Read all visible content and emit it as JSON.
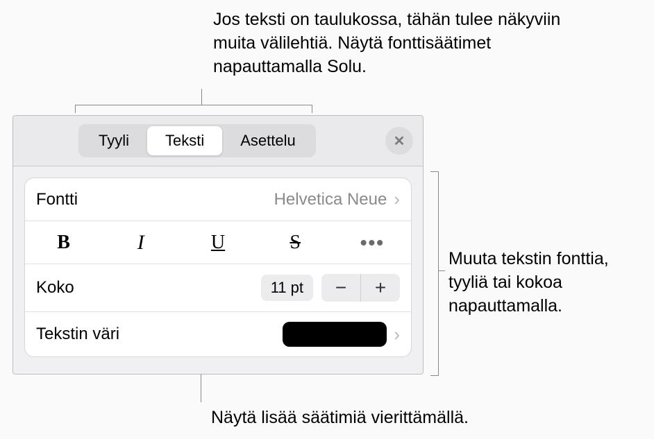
{
  "callouts": {
    "top": "Jos teksti on taulukossa, tähän tulee näkyviin muita välilehtiä. Näytä fonttisäätimet napauttamalla Solu.",
    "right": "Muuta tekstin fonttia, tyyliä tai kokoa napauttamalla.",
    "bottom": "Näytä lisää säätimiä vierittämällä."
  },
  "tabs": {
    "style": "Tyyli",
    "text": "Teksti",
    "layout": "Asettelu"
  },
  "icons": {
    "close_glyph": "✕",
    "chevron_glyph": "›",
    "minus_glyph": "−",
    "plus_glyph": "+",
    "bold_glyph": "B",
    "italic_glyph": "I",
    "underline_glyph": "U",
    "strike_glyph": "S",
    "more_glyph": "•••"
  },
  "font": {
    "label": "Fontti",
    "value": "Helvetica Neue"
  },
  "size": {
    "label": "Koko",
    "value": "11 pt"
  },
  "text_color": {
    "label": "Tekstin väri",
    "swatch_hex": "#000000"
  }
}
